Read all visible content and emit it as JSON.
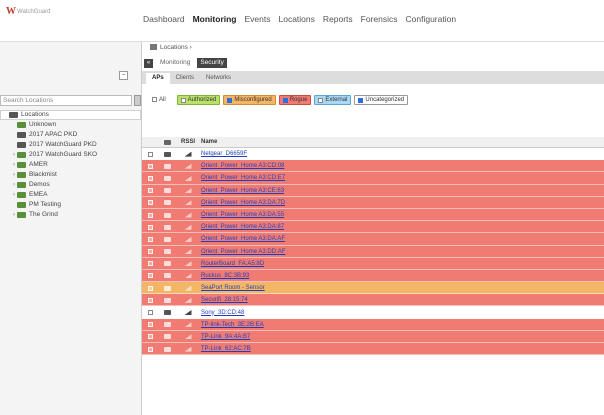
{
  "app": {
    "logo_mark": "W",
    "logo_text": "WatchGuard"
  },
  "nav": {
    "items": [
      "Dashboard",
      "Monitoring",
      "Events",
      "Locations",
      "Reports",
      "Forensics",
      "Configuration"
    ],
    "active": "Monitoring"
  },
  "sidebar": {
    "search_placeholder": "Search Locations",
    "root": "Locations",
    "items": [
      {
        "label": "Unknown",
        "expandable": false,
        "color": "#5a8f3a"
      },
      {
        "label": "2017 APAC PKD",
        "expandable": false,
        "color": "#555"
      },
      {
        "label": "2017 WatchGuard PKD",
        "expandable": false,
        "color": "#555"
      },
      {
        "label": "2017 WatchGuard SKO",
        "expandable": true,
        "color": "#5a8f3a"
      },
      {
        "label": "AMER",
        "expandable": true,
        "color": "#5a8f3a"
      },
      {
        "label": "Blackmist",
        "expandable": true,
        "color": "#5a8f3a"
      },
      {
        "label": "Demos",
        "expandable": true,
        "color": "#5a8f3a"
      },
      {
        "label": "EMEA",
        "expandable": true,
        "color": "#5a8f3a"
      },
      {
        "label": "PM Testing",
        "expandable": false,
        "color": "#5a8f3a"
      },
      {
        "label": "The Grind",
        "expandable": true,
        "color": "#5a8f3a"
      }
    ]
  },
  "breadcrumb": {
    "label": "Locations",
    "sep": "›"
  },
  "view_tabs": {
    "items": [
      "Monitoring",
      "Security"
    ],
    "active": "Security"
  },
  "sub_tabs": {
    "items": [
      "APs",
      "Clients",
      "Networks"
    ],
    "active": "APs"
  },
  "filters": {
    "all_label": "All",
    "chips": [
      {
        "label": "Authorized",
        "bg": "#b8e06b",
        "border": "#7fb63a",
        "checked": false
      },
      {
        "label": "Misconfigured",
        "bg": "#f5b567",
        "border": "#d88a2e",
        "checked": true
      },
      {
        "label": "Rogue",
        "bg": "#f07b73",
        "border": "#cf4a40",
        "checked": true
      },
      {
        "label": "External",
        "bg": "#a9d8f5",
        "border": "#5aa7d8",
        "checked": false
      },
      {
        "label": "Uncategorized",
        "bg": "#ffffff",
        "border": "#999999",
        "checked": true
      }
    ]
  },
  "table": {
    "headers": {
      "icon": "",
      "rssi": "RSSI",
      "name": "Name"
    },
    "rows": [
      {
        "name": "Netgear_D6659F",
        "status": "white"
      },
      {
        "name": "Orient_Power_Home A3:CD:08",
        "status": "rogue"
      },
      {
        "name": "Orient_Power_Home A3:CD:E7",
        "status": "rogue"
      },
      {
        "name": "Orient_Power_Home A3:CE:63",
        "status": "rogue"
      },
      {
        "name": "Orient_Power_Home A3:DA:7D",
        "status": "rogue"
      },
      {
        "name": "Orient_Power_Home A3:DA:55",
        "status": "rogue"
      },
      {
        "name": "Orient_Power_Home A3:DA:87",
        "status": "rogue"
      },
      {
        "name": "Orient_Power_Home A3:DA:AF",
        "status": "rogue"
      },
      {
        "name": "Orient_Power_Home A3:DD:AF",
        "status": "rogue"
      },
      {
        "name": "RouterBoard_FA:A5:8D",
        "status": "rogue"
      },
      {
        "name": "Ruckus_8C:3B:93",
        "status": "rogue"
      },
      {
        "name": "SeaPort Room - Sensor",
        "status": "misconfigured"
      },
      {
        "name": "Securifi_28:15:74",
        "status": "rogue"
      },
      {
        "name": "Sony_3D:CD:48",
        "status": "white"
      },
      {
        "name": "TP-link-Tech_3E:2B:EA",
        "status": "rogue"
      },
      {
        "name": "TP-Link_9A:4A:B7",
        "status": "rogue"
      },
      {
        "name": "TP-Link_62:AC:7B",
        "status": "rogue"
      }
    ]
  },
  "colors": {
    "rogue": "#f07b73",
    "misconfigured": "#f5b567",
    "white": "#ffffff"
  }
}
